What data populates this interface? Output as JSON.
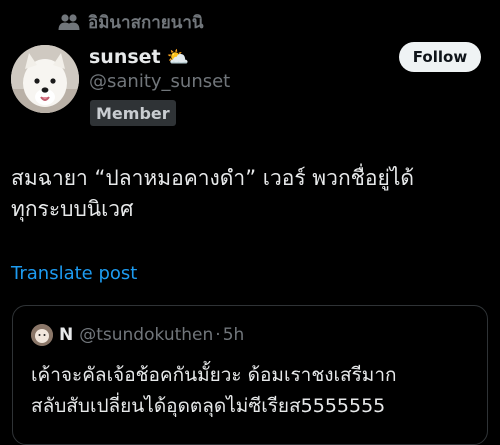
{
  "community": {
    "name": "อิมินาสกายนานิ",
    "icon": "people-icon"
  },
  "author": {
    "display_name": "sunset",
    "emoji": "⛅",
    "handle": "@sanity_sunset",
    "badge": "Member"
  },
  "follow_label": "Follow",
  "post": {
    "lines": [
      "สมฉายา “ปลาหมอคางดำ” เวอร์ พวกชื่อยู่ได้",
      "ทุกระบบนิเวศ"
    ],
    "translate_label": "Translate post"
  },
  "quoted": {
    "name": "N",
    "handle": "@tsundokuthen",
    "separator": "·",
    "time": "5h",
    "lines": [
      "เค้าจะคัลเจ้อช้อคกันมั้ยวะ ด้อมเราชงเสรีมาก",
      "สลับสับเปลี่ยนได้อุดตลุดไม่ซีเรียส5555555"
    ]
  },
  "colors": {
    "background": "#000000",
    "text": "#e7e9ea",
    "muted": "#71767b",
    "link": "#1d9bf0",
    "border": "#2f3336"
  }
}
